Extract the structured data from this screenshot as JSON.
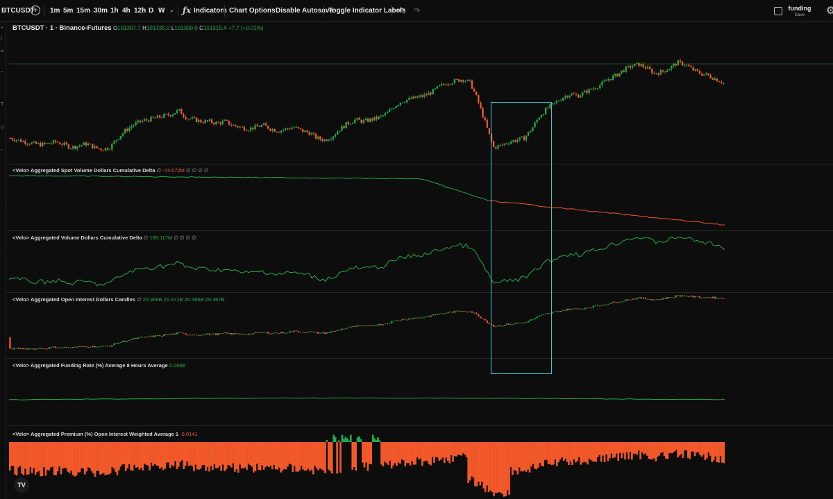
{
  "toolbar": {
    "symbol": "BTCUSDT",
    "intervals": [
      "1m",
      "5m",
      "15m",
      "30m",
      "1h",
      "4h",
      "12h",
      "D",
      "W"
    ],
    "indicators_label": "Indicators",
    "chart_options_label": "Chart Options",
    "disable_autosave_label": "Disable Autosave",
    "toggle_labels_label": "Toggle Indicator Labels",
    "layout_name": "funding",
    "layout_save": "Save"
  },
  "main_pane": {
    "symbol_title": "BTCUSDT · 1 · Binance-Futures",
    "open_key": "O",
    "open": "101307.7",
    "high_key": "H",
    "high": "101335.0",
    "low_key": "L",
    "low": "101300.0",
    "close_key": "C",
    "close": "101315.4",
    "change": "+7.7 (+0.01%)"
  },
  "indicators": [
    {
      "name": "<Velo> Aggregated Spot Volume Dollars Cumulative Delta",
      "marker": "∅",
      "value": "-74.072M",
      "extra": "∅ ∅ ∅ ∅",
      "value_color": "#f2592a"
    },
    {
      "name": "<Velo> Aggregated Volume Dollars Cumulative Delta",
      "marker": "∅",
      "value": "195.117M",
      "extra": "∅ ∅ ∅ ∅",
      "value_color": "#22ab4a"
    },
    {
      "name": "<Velo> Aggregated Open Interest Dollars Candles",
      "marker": "∅",
      "value": "20.366B  20.371B  20.366B  20.367B",
      "extra": "",
      "value_color": "#22ab4a"
    },
    {
      "name": "<Velo> Aggregated Funding Rate (%) Average 8 Hours Average",
      "marker": "",
      "value": "0.0068",
      "extra": "",
      "value_color": "#22ab4a"
    },
    {
      "name": "<Velo> Aggregated Premium (%) Open Interest Weighted Average 1",
      "marker": "",
      "value": "-0.0141",
      "extra": "",
      "value_color": "#f2592a"
    }
  ],
  "logo_text": "TV",
  "colors": {
    "up": "#22ab4a",
    "down": "#f2592a",
    "highlight": "#38c8d0",
    "background": "#0d0d0d"
  },
  "chart_data": {
    "type": "candlestick",
    "symbol": "BTCUSDT",
    "price_series_shape": [
      0.4,
      0.38,
      0.36,
      0.34,
      0.33,
      0.34,
      0.36,
      0.33,
      0.3,
      0.32,
      0.34,
      0.3,
      0.28,
      0.3,
      0.4,
      0.48,
      0.54,
      0.58,
      0.6,
      0.62,
      0.64,
      0.66,
      0.7,
      0.62,
      0.6,
      0.58,
      0.58,
      0.56,
      0.58,
      0.54,
      0.52,
      0.5,
      0.52,
      0.54,
      0.5,
      0.48,
      0.5,
      0.52,
      0.48,
      0.46,
      0.4,
      0.38,
      0.42,
      0.5,
      0.56,
      0.6,
      0.58,
      0.6,
      0.62,
      0.66,
      0.74,
      0.8,
      0.82,
      0.84,
      0.86,
      0.9,
      0.96,
      1.0,
      1.02,
      1.04,
      1.0,
      0.8,
      0.55,
      0.3,
      0.32,
      0.36,
      0.38,
      0.4,
      0.5,
      0.64,
      0.72,
      0.78,
      0.84,
      0.88,
      0.86,
      0.9,
      0.94,
      0.98,
      1.04,
      1.08,
      1.14,
      1.18,
      1.2,
      1.16,
      1.1,
      1.12,
      1.16,
      1.22,
      1.2,
      1.14,
      1.1,
      1.08,
      1.04,
      1.0
    ],
    "spot_cvd_end": "-74.072M",
    "cvd_end": "195.117M",
    "open_interest_ohlc": [
      "20.366B",
      "20.371B",
      "20.366B",
      "20.367B"
    ],
    "funding_rate_avg_8h": "0.0068",
    "premium_oi_weighted": "-0.0141"
  }
}
